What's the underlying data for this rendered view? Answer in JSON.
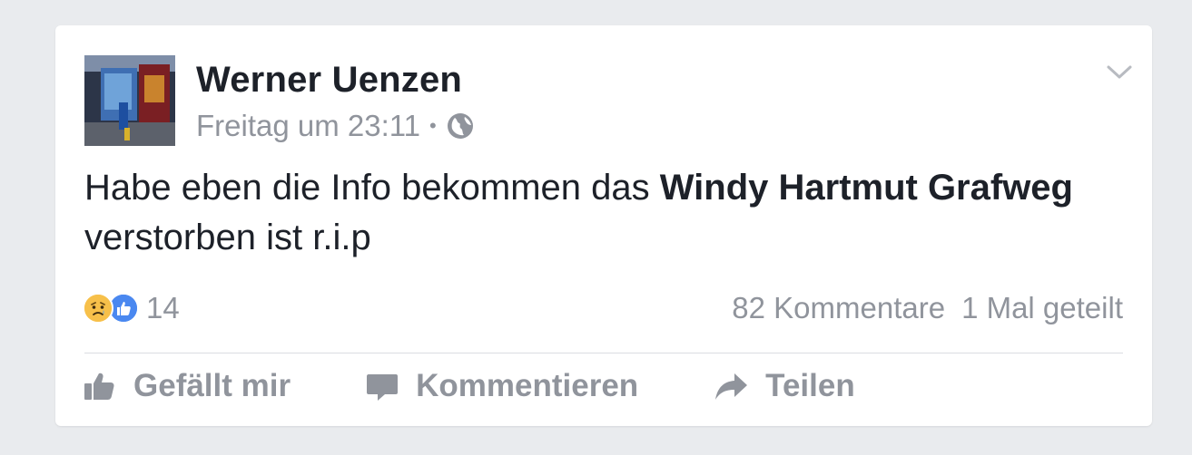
{
  "post": {
    "author": "Werner Uenzen",
    "timestamp": "Freitag um 23:11",
    "separator": "•",
    "privacy_icon": "globe-icon",
    "menu_icon": "chevron-down-icon",
    "text_part1": "Habe eben die Info bekommen das ",
    "text_bold": "Windy Hartmut Grafweg",
    "text_part2": " verstorben ist r.i.p"
  },
  "reactions": {
    "icons": [
      "sad-reaction-icon",
      "like-reaction-icon"
    ],
    "count": "14"
  },
  "stats": {
    "comments": "82 Kommentare",
    "shares": "1 Mal geteilt"
  },
  "actions": {
    "like": "Gefällt mir",
    "comment": "Kommentieren",
    "share": "Teilen"
  },
  "colors": {
    "background": "#e9ebee",
    "card": "#ffffff",
    "text": "#1d2129",
    "muted": "#90949c",
    "like_blue": "#4a88f0",
    "sad_yellow": "#f7c04a"
  }
}
